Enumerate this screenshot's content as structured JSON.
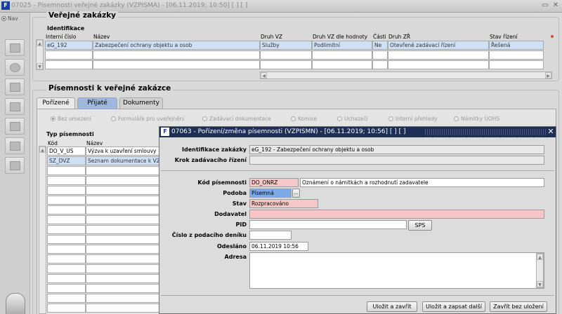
{
  "window": {
    "title": "07025 - Písemnosti veřejné zakázky (VZPISMA) - [06.11.2019; 10:50]  [ ]  [ ]"
  },
  "nav": {
    "label": "Nav"
  },
  "vz_panel": {
    "title": "Veřejné zakázky",
    "section": "Identifikace",
    "headers": [
      "Interní číslo",
      "Název",
      "Druh VZ",
      "Druh VZ dle hodnoty",
      "Části",
      "Druh ZŘ",
      "Stav řízení"
    ],
    "row": [
      "eG_192",
      "Zabezpečení ochrany objektu a osob",
      "Služby",
      "Podlimitní",
      "Ne",
      "Otevřené zadávací řízení",
      "Řešená"
    ]
  },
  "pis_panel": {
    "title": "Písemnosti k veřejné zakázce",
    "tabs": [
      "Pořízené",
      "Přijaté",
      "Dokumenty"
    ],
    "radios": [
      "Bez omezení",
      "Formuláře pro uveřejnění",
      "Zadávací dokumentace",
      "Komise",
      "Uchazeči",
      "Interní přehledy",
      "Námitky ÚOHS"
    ],
    "type_section": "Typ písemnosti",
    "headers": [
      "Kód",
      "Název"
    ],
    "rows": [
      {
        "kod": "DO_V_US",
        "nazev": "Výzva k uzavření smlouvy"
      },
      {
        "kod": "SZ_DVZ",
        "nazev": "Seznam dokumentace k VZ"
      }
    ]
  },
  "dialog": {
    "title": "07063 - Pořízení/změna písemnosti (VZPISMN) - [06.11.2019; 10:56]  [ ]  [ ]",
    "labels": {
      "ident": "Identifikace zakázky",
      "krok": "Krok zadávacího řízení",
      "kod": "Kód písemnosti",
      "podoba": "Podoba",
      "stav": "Stav",
      "dodavatel": "Dodavatel",
      "pid": "PID",
      "cislo": "Číslo z podacího deníku",
      "odeslano": "Odesláno",
      "adresa": "Adresa"
    },
    "values": {
      "ident": "eG_192 - Zabezpečení ochrany objektu a osob",
      "krok": "",
      "kod": "DO_ONRZ",
      "kod_nazev": "Oznámení o námitkách a rozhodnutí zadavatele",
      "podoba": "Písemná",
      "stav": "Rozpracováno",
      "dodavatel": "",
      "pid": "",
      "cislo": "",
      "odeslano": "06.11.2019 10:56",
      "adresa": ""
    },
    "buttons": {
      "sps": "SPS",
      "lov": "...",
      "save_close": "Uložit a zavřít",
      "save_next": "Uložit a zapsat další",
      "close_nosave": "Zavřít bez uložení"
    }
  }
}
